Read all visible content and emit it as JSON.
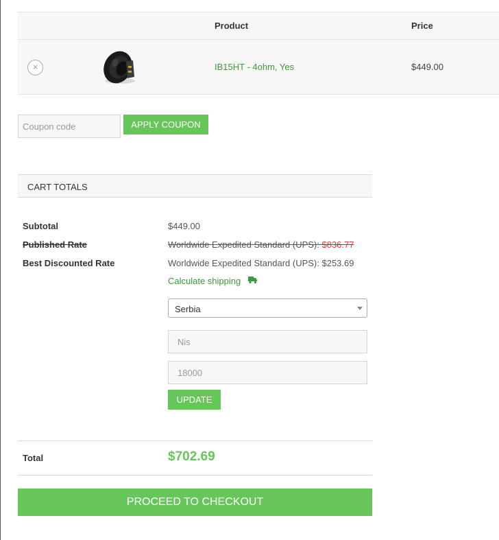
{
  "cart_table": {
    "headers": {
      "product": "Product",
      "price": "Price"
    },
    "row": {
      "remove_glyph": "×",
      "product_name": "IB15HT - 4ohm, Yes",
      "price": "$449.00",
      "thumbnail_icon": "speaker-image"
    }
  },
  "coupon": {
    "placeholder": "Coupon code",
    "apply_label": "APPLY COUPON"
  },
  "cart_totals": {
    "heading": "CART TOTALS",
    "subtotal_label": "Subtotal",
    "subtotal_value": "$449.00",
    "published_rate_label": "Published Rate",
    "published_rate_text": "Worldwide Expedited Standard (UPS): ",
    "published_rate_amount": "$836.77",
    "best_rate_label": "Best Discounted Rate",
    "best_rate_value": "Worldwide Expedited Standard (UPS): $253.69",
    "calculate_shipping": "Calculate shipping",
    "shipping_icon": "truck-icon",
    "country_selected": "Serbia",
    "city_value": "Nis",
    "postcode_value": "18000",
    "update_label": "UPDATE",
    "total_label": "Total",
    "total_value": "$702.69"
  },
  "checkout": {
    "label": "PROCEED TO CHECKOUT"
  },
  "colors": {
    "accent": "#66c65a",
    "link": "#3a9a3a",
    "strike_red": "#e53a3a"
  }
}
